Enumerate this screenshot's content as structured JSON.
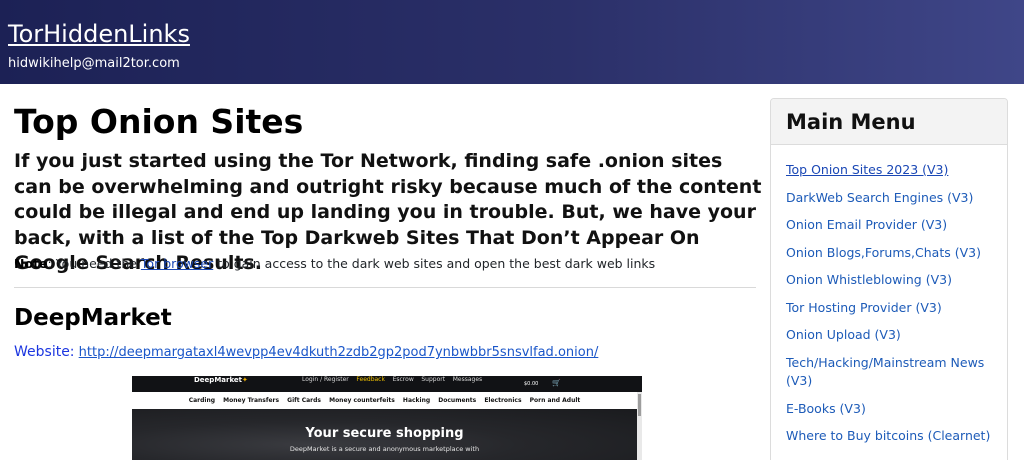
{
  "header": {
    "site_title": "TorHiddenLinks",
    "email": "hidwikihelp@mail2tor.com",
    "background_colors": [
      "#1c2155",
      "#3f4688"
    ]
  },
  "main": {
    "page_title": "Top Onion Sites",
    "intro": "If you just started using the Tor Network, finding safe .onion sites can be overwhelming and outright risky because much of the content could be illegal and end up landing you in trouble. But, we have your back, with a list of the Top Darkweb Sites That Don’t Appear On Google Search Results.",
    "note": {
      "label": "Note",
      "prefix": ": You need the ",
      "link_text": "Tor browser",
      "suffix": " to gain access to the dark web sites and open the best dark web links"
    },
    "listing": {
      "name": "DeepMarket",
      "website_label": "Website:",
      "url": "http://deepmargataxl4wevpp4ev4dkuth2zdb2gp2pod7ynbwbbr5snsvlfad.onion/",
      "preview": {
        "logo": "DeepMarket",
        "top_nav": [
          "Login / Register",
          "Feedback",
          "Escrow",
          "Support",
          "Messages"
        ],
        "highlighted_nav": "Feedback",
        "balance": "$0.00",
        "categories": [
          "Carding",
          "Money Transfers",
          "Gift Cards",
          "Money counterfeits",
          "Hacking",
          "Documents",
          "Electronics",
          "Porn and Adult"
        ],
        "hero_title": "Your secure shopping",
        "hero_subtitle": "DeepMarket is a secure and anonymous marketplace with"
      }
    }
  },
  "sidebar": {
    "title": "Main Menu",
    "items": [
      {
        "label": "Top Onion Sites 2023 (V3)",
        "active": true
      },
      {
        "label": "DarkWeb Search Engines (V3)",
        "active": false
      },
      {
        "label": "Onion Email Provider (V3)",
        "active": false
      },
      {
        "label": "Onion Blogs,Forums,Chats (V3)",
        "active": false
      },
      {
        "label": "Onion Whistleblowing (V3)",
        "active": false
      },
      {
        "label": "Tor Hosting Provider (V3)",
        "active": false
      },
      {
        "label": "Onion Upload (V3)",
        "active": false
      },
      {
        "label": "Tech/Hacking/Mainstream News (V3)",
        "active": false
      },
      {
        "label": "E-Books (V3)",
        "active": false
      },
      {
        "label": "Where to Buy bitcoins (Clearnet)",
        "active": false
      }
    ]
  },
  "colors": {
    "link": "#1a47b5",
    "website_label": "#1c36e0",
    "menu_link": "#1d5bb8"
  }
}
